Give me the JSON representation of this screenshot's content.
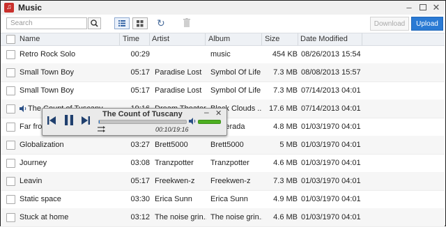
{
  "window": {
    "title": "Music"
  },
  "toolbar": {
    "search_placeholder": "Search",
    "download_label": "Download",
    "upload_label": "Upload"
  },
  "columns": [
    "Name",
    "Time",
    "Artist",
    "Album",
    "Size",
    "Date Modified"
  ],
  "rows": [
    {
      "name": "Retro Rock Solo",
      "time": "00:29",
      "artist": "",
      "album": "music",
      "size": "454 KB",
      "date": "08/26/2013 15:54"
    },
    {
      "name": "Small Town Boy",
      "time": "05:17",
      "artist": "Paradise Lost",
      "album": "Symbol Of Life",
      "size": "7.3 MB",
      "date": "08/08/2013 15:57"
    },
    {
      "name": "Small Town Boy",
      "time": "05:17",
      "artist": "Paradise Lost",
      "album": "Symbol Of Life",
      "size": "7.3 MB",
      "date": "07/14/2013 04:01"
    },
    {
      "name": "The Count of Tuscany",
      "time": "19:16",
      "artist": "Dream Theater",
      "album": "Black Clouds ...",
      "size": "17.6 MB",
      "date": "07/14/2013 04:01",
      "playing": true
    },
    {
      "name": "Far from ...",
      "time": "",
      "artist": "",
      "album": "...querada",
      "size": "4.8 MB",
      "date": "01/03/1970 04:01"
    },
    {
      "name": "Globalization",
      "time": "03:27",
      "artist": "Brett5000",
      "album": "Brett5000",
      "size": "5 MB",
      "date": "01/03/1970 04:01"
    },
    {
      "name": "Journey",
      "time": "03:08",
      "artist": "Tranzpotter",
      "album": "Tranzpotter",
      "size": "4.6 MB",
      "date": "01/03/1970 04:01"
    },
    {
      "name": "Leavin",
      "time": "05:17",
      "artist": "Freekwen-z",
      "album": "Freekwen-z",
      "size": "7.3 MB",
      "date": "01/03/1970 04:01"
    },
    {
      "name": "Static space",
      "time": "03:30",
      "artist": "Erica Sunn",
      "album": "Erica Sunn",
      "size": "4.9 MB",
      "date": "01/03/1970 04:01"
    },
    {
      "name": "Stuck at home",
      "time": "03:12",
      "artist": "The noise grin...",
      "album": "The noise grin...",
      "size": "4.6 MB",
      "date": "01/03/1970 04:01"
    }
  ],
  "player": {
    "title": "The Count of Tuscany",
    "time_display": "00:10/19:16",
    "progress_fraction": 0.0087,
    "volume_fraction": 1.0
  },
  "colors": {
    "accent": "#2a7ad4",
    "volume": "#4caf20",
    "app_icon": "#c9302c"
  },
  "icons": [
    "music-app-icon",
    "minimize-icon",
    "maximize-icon",
    "close-icon",
    "search-icon",
    "list-view-icon",
    "grid-view-icon",
    "refresh-icon",
    "trash-icon",
    "speaker-icon",
    "previous-icon",
    "pause-icon",
    "next-icon",
    "shuffle-icon",
    "volume-icon"
  ]
}
